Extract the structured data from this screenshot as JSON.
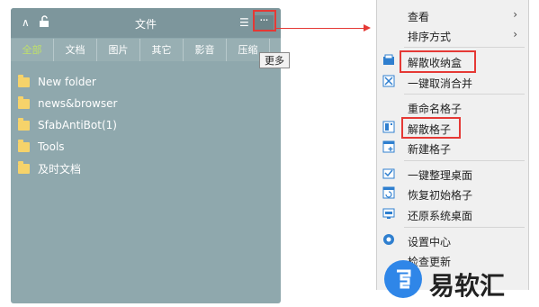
{
  "fence": {
    "title": "文件",
    "tabs": [
      "全部",
      "文档",
      "图片",
      "其它",
      "影音",
      "压缩"
    ],
    "files": [
      "New folder",
      "news&browser",
      "SfabAntiBot(1)",
      "Tools",
      "及时文档"
    ],
    "more_tooltip": "更多"
  },
  "menu": {
    "items": [
      {
        "label": "查看",
        "submenu": true,
        "icon": ""
      },
      {
        "label": "排序方式",
        "submenu": true,
        "icon": ""
      },
      {
        "label": "解散收纳盒",
        "submenu": false,
        "icon": "folder-box-icon"
      },
      {
        "label": "一键取消合并",
        "submenu": false,
        "icon": "unmerge-icon"
      },
      {
        "label": "重命名格子",
        "submenu": false,
        "icon": ""
      },
      {
        "label": "解散格子",
        "submenu": false,
        "icon": "dissolve-grid-icon"
      },
      {
        "label": "新建格子",
        "submenu": false,
        "icon": "new-grid-icon"
      },
      {
        "label": "一键整理桌面",
        "submenu": false,
        "icon": "organize-icon"
      },
      {
        "label": "恢复初始格子",
        "submenu": false,
        "icon": "restore-grid-icon"
      },
      {
        "label": "还原系统桌面",
        "submenu": false,
        "icon": "system-desktop-icon"
      },
      {
        "label": "设置中心",
        "submenu": false,
        "icon": "gear-icon"
      },
      {
        "label": "检查更新",
        "submenu": false,
        "icon": ""
      }
    ],
    "submenu_glyph": "›"
  },
  "watermark": {
    "text": "易软汇"
  },
  "colors": {
    "highlight": "#e53935",
    "fence_bg": "#8fa8ad",
    "active_tab": "#bfe06a"
  }
}
